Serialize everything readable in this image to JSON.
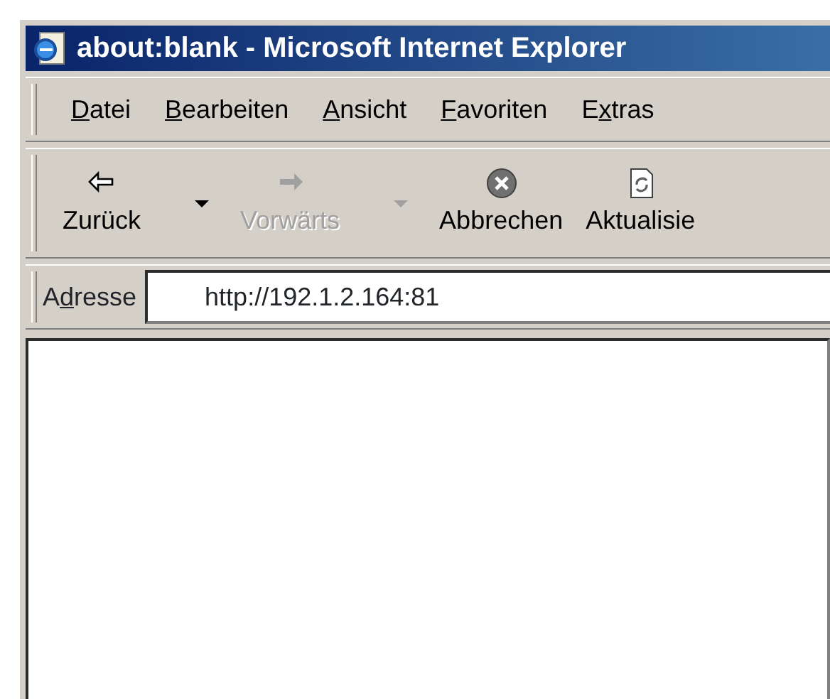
{
  "window": {
    "title": "about:blank - Microsoft Internet Explorer"
  },
  "menu": [
    {
      "access_key": "D",
      "label_rest": "atei"
    },
    {
      "access_key": "B",
      "label_rest": "earbeiten"
    },
    {
      "access_key": "A",
      "label_rest": "nsicht"
    },
    {
      "access_key": "F",
      "label_rest": "avoriten"
    },
    {
      "label_start": "E",
      "access_key": "x",
      "label_rest": "tras"
    }
  ],
  "toolbar": [
    {
      "label": "Zurück",
      "kind": "back",
      "disabled": false,
      "dropdown": true
    },
    {
      "label": "Vorwärts",
      "kind": "forward",
      "disabled": true,
      "dropdown": true
    },
    {
      "label": "Abbrechen",
      "kind": "stop",
      "disabled": false,
      "dropdown": false
    },
    {
      "label": "Aktualisie",
      "kind": "refresh",
      "disabled": false,
      "dropdown": false
    }
  ],
  "address": {
    "label_start": "A",
    "access_key": "d",
    "label_rest": "resse",
    "value": "http://192.1.2.164:81"
  }
}
